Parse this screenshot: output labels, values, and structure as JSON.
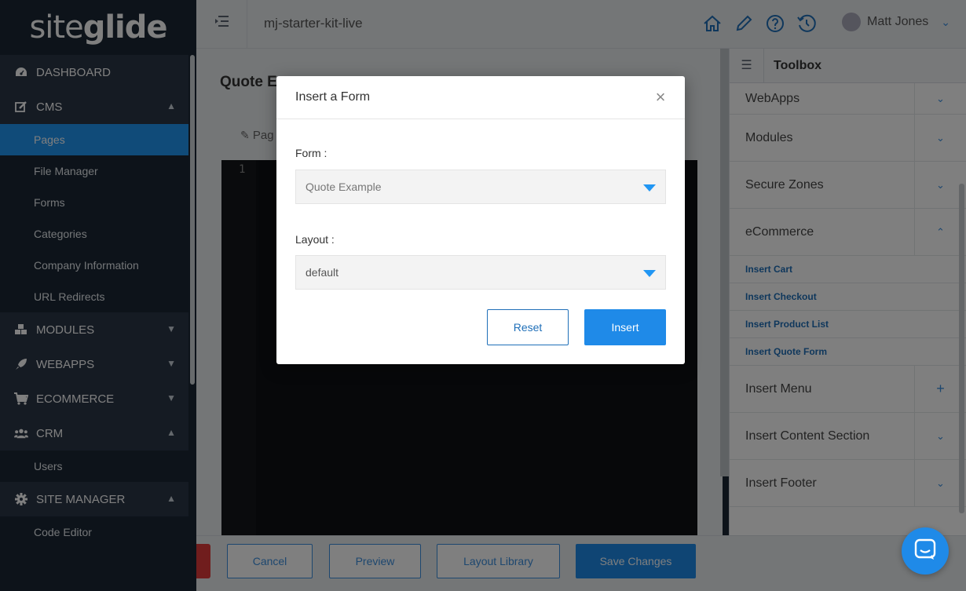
{
  "app": {
    "logo": {
      "part1": "site",
      "part2": "glide"
    }
  },
  "sidebar": {
    "sections": [
      {
        "label": "DASHBOARD",
        "icon": "dashboard-icon",
        "expanded": null
      },
      {
        "label": "CMS",
        "icon": "edit-icon",
        "expanded": true,
        "items": [
          "Pages",
          "File Manager",
          "Forms",
          "Categories",
          "Company Information",
          "URL Redirects"
        ]
      },
      {
        "label": "MODULES",
        "icon": "cubes-icon",
        "expanded": false
      },
      {
        "label": "WEBAPPS",
        "icon": "rocket-icon",
        "expanded": false
      },
      {
        "label": "ECOMMERCE",
        "icon": "cart-icon",
        "expanded": false
      },
      {
        "label": "CRM",
        "icon": "users-icon",
        "expanded": true,
        "items": [
          "Users"
        ]
      },
      {
        "label": "SITE MANAGER",
        "icon": "gear-icon",
        "expanded": true,
        "items": [
          "Code Editor"
        ]
      }
    ],
    "active_item": "Pages"
  },
  "topbar": {
    "site_name": "mj-starter-kit-live",
    "user_name": "Matt Jones"
  },
  "main": {
    "title": "Quote E",
    "page_tab": "Pag",
    "editor_line": "1"
  },
  "toolbox": {
    "title": "Toolbox",
    "rows": [
      {
        "label": "WebApps",
        "chevron": "down"
      },
      {
        "label": "Modules",
        "chevron": "down"
      },
      {
        "label": "Secure Zones",
        "chevron": "down"
      },
      {
        "label": "eCommerce",
        "chevron": "up"
      }
    ],
    "ecommerce_items": [
      "Insert Cart",
      "Insert Checkout",
      "Insert Product List",
      "Insert Quote Form"
    ],
    "rows_after": [
      {
        "label": "Insert Menu",
        "chevron": "plus"
      },
      {
        "label": "Insert Content Section",
        "chevron": "down"
      },
      {
        "label": "Insert Footer",
        "chevron": "down"
      }
    ]
  },
  "bottombar": {
    "cancel": "Cancel",
    "preview": "Preview",
    "layout_library": "Layout Library",
    "save": "Save Changes"
  },
  "modal": {
    "title": "Insert a Form",
    "form_label": "Form :",
    "form_value": "Quote Example",
    "layout_label": "Layout :",
    "layout_value": "default",
    "reset": "Reset",
    "insert": "Insert"
  },
  "colors": {
    "accent": "#1f8ae8",
    "sidebar": "#1b2735",
    "active": "#2196f3"
  }
}
